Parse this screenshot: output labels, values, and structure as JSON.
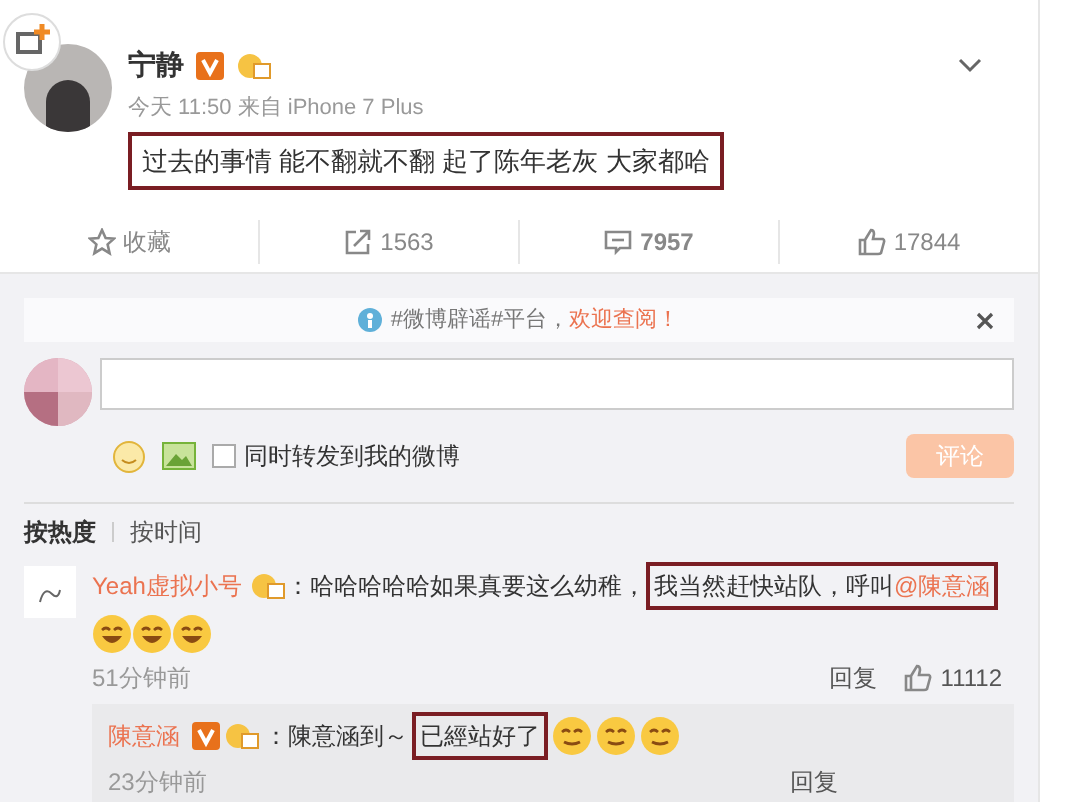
{
  "post": {
    "author": "宁静",
    "verified": true,
    "time": "今天 11:50 来自 iPhone 7 Plus",
    "text": "过去的事情 能不翻就不翻 起了陈年老灰 大家都哈",
    "highlight": true
  },
  "actions": [
    {
      "kind": "favorite",
      "label": "收藏",
      "selected": false
    },
    {
      "kind": "repost",
      "label": "1563",
      "selected": false
    },
    {
      "kind": "comment",
      "label": "7957",
      "selected": true
    },
    {
      "kind": "like",
      "label": "17844",
      "selected": false
    }
  ],
  "notice": {
    "text": "#微博辟谣#平台，",
    "link": "欢迎查阅！"
  },
  "composer": {
    "checkbox_label": "同时转发到我的微博",
    "checked": false,
    "submit": "评论",
    "disabled": true
  },
  "sort_tabs": [
    {
      "label": "按热度",
      "selected": true
    },
    {
      "label": "按时间",
      "selected": false
    }
  ],
  "comments": [
    {
      "author": "Yeah虚拟小号",
      "verified": false,
      "parts": [
        {
          "highlight": false,
          "spans": [
            {
              "text": "：哈哈哈哈哈如果真要这么幼稚，",
              "link": false
            }
          ]
        },
        {
          "highlight": true,
          "spans": [
            {
              "text": "我当然赶快站队，呼叫",
              "link": false
            },
            {
              "text": "@陳意涵",
              "link": true
            }
          ]
        }
      ],
      "emojis": [
        {
          "kind": "laugh"
        },
        {
          "kind": "laugh"
        },
        {
          "kind": "laugh"
        }
      ],
      "time": "51分钟前",
      "reply": "回复",
      "likes": "11112",
      "replies": [
        {
          "author": "陳意涵",
          "verified": true,
          "parts": [
            {
              "highlight": false,
              "spans": [
                {
                  "text": "：陳意涵到～",
                  "link": false
                }
              ]
            },
            {
              "highlight": true,
              "spans": [
                {
                  "text": "已經站好了",
                  "link": false
                }
              ]
            }
          ],
          "emojis": [
            {
              "kind": "giggle"
            },
            {
              "kind": "giggle"
            },
            {
              "kind": "giggle"
            }
          ],
          "time": "23分钟前",
          "reply": "回复"
        }
      ]
    }
  ]
}
